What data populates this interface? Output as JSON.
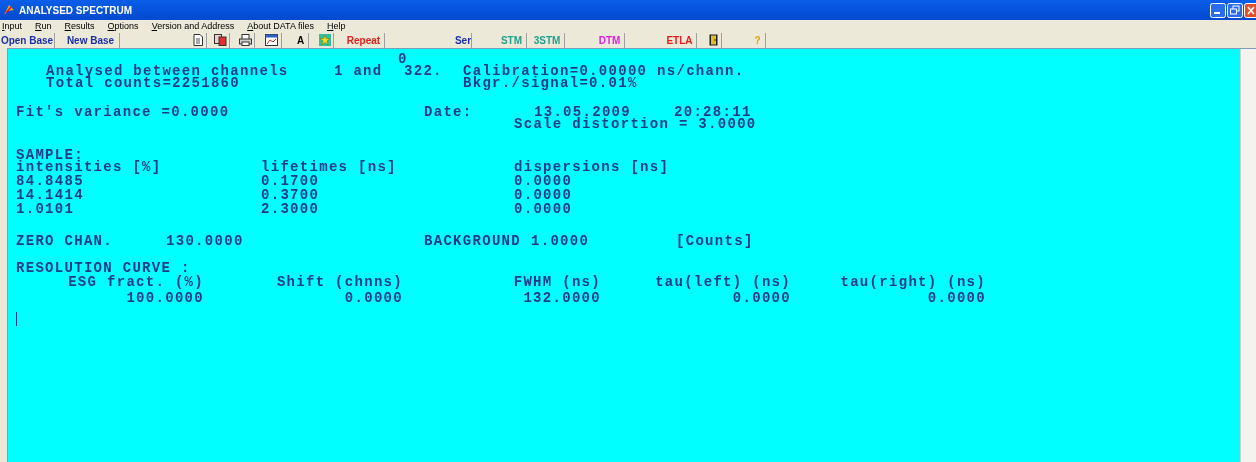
{
  "window": {
    "title": "ANALYSED SPECTRUM"
  },
  "menu": [
    "Input",
    "Run",
    "Results",
    "Options",
    "Version and Address",
    "About DATA files",
    "Help"
  ],
  "toolbar": [
    {
      "kind": "text",
      "label": "Open Base",
      "color": "#1c2fa8"
    },
    {
      "kind": "text",
      "label": "New Base",
      "color": "#1c2fa8"
    },
    {
      "kind": "icon"
    },
    {
      "kind": "icon"
    },
    {
      "kind": "icon"
    },
    {
      "kind": "icon"
    },
    {
      "kind": "text",
      "label": "A",
      "color": "#000000"
    },
    {
      "kind": "icon"
    },
    {
      "kind": "text",
      "label": "Repeat",
      "color": "#e0201c"
    },
    {
      "kind": "text",
      "label": "Ser",
      "color": "#1c2fa8"
    },
    {
      "kind": "text",
      "label": "STM",
      "color": "#23a08a"
    },
    {
      "kind": "text",
      "label": "3STM",
      "color": "#23a08a"
    },
    {
      "kind": "text",
      "label": "DTM",
      "color": "#e020e0"
    },
    {
      "kind": "text",
      "label": "ETLA",
      "color": "#e02020"
    },
    {
      "kind": "icon"
    },
    {
      "kind": "text",
      "label": "?",
      "color": "#e0a000"
    }
  ],
  "report": {
    "channel_marker": "0",
    "analysed_label": "Analysed between channels",
    "channel_from": "1 and",
    "channel_to": "322.",
    "calibration": "Calibration=0.00000 ns/chann.",
    "total_counts": "Total counts=2251860",
    "bkgr_signal": "Bkgr./signal=0.01%",
    "fit_variance": "Fit's variance =0.0000",
    "date_label": "Date:",
    "date": "13.05.2009",
    "time": "20:28:11",
    "scale_distortion": "Scale distortion = 3.0000",
    "sample_title": "SAMPLE:",
    "sample_columns": [
      "intensities [%]",
      "lifetimes [ns]",
      "dispersions [ns]"
    ],
    "sample_rows": [
      [
        "84.8485",
        "0.1700",
        "0.0000"
      ],
      [
        "14.1414",
        "0.3700",
        "0.0000"
      ],
      [
        "1.0101",
        "2.3000",
        "0.0000"
      ]
    ],
    "zero_chan_label": "ZERO CHAN.",
    "zero_chan": "130.0000",
    "background_label": "BACKGROUND",
    "background": "1.0000",
    "background_unit": "[Counts]",
    "resolution_title": "RESOLUTION CURVE :",
    "resolution_columns": [
      "ESG fract. (%)",
      "Shift (chnns)",
      "FWHM (ns)",
      "tau(left) (ns)",
      "tau(right) (ns)"
    ],
    "resolution_values": [
      "100.0000",
      "0.0000",
      "132.0000",
      "0.0000",
      "0.0000"
    ]
  }
}
